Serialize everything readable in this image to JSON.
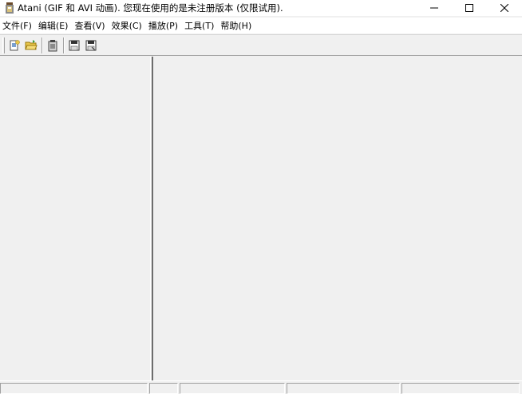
{
  "titlebar": {
    "title": "Atani (GIF 和 AVI 动画). 您现在使用的是未注册版本 (仅限试用).",
    "app_icon": "atani-app-icon",
    "controls": [
      "minimize-icon",
      "maximize-icon",
      "close-icon"
    ]
  },
  "menubar": {
    "items": [
      {
        "label": "文件(F)"
      },
      {
        "label": "编辑(E)"
      },
      {
        "label": "查看(V)"
      },
      {
        "label": "效果(C)"
      },
      {
        "label": "播放(P)"
      },
      {
        "label": "工具(T)"
      },
      {
        "label": "帮助(H)"
      }
    ]
  },
  "toolbar": {
    "buttons": [
      "new-icon",
      "open-icon",
      "properties-icon",
      "save-icon",
      "save-as-icon"
    ]
  },
  "statusbar": {
    "panels": [
      "",
      "",
      "",
      "",
      ""
    ]
  }
}
